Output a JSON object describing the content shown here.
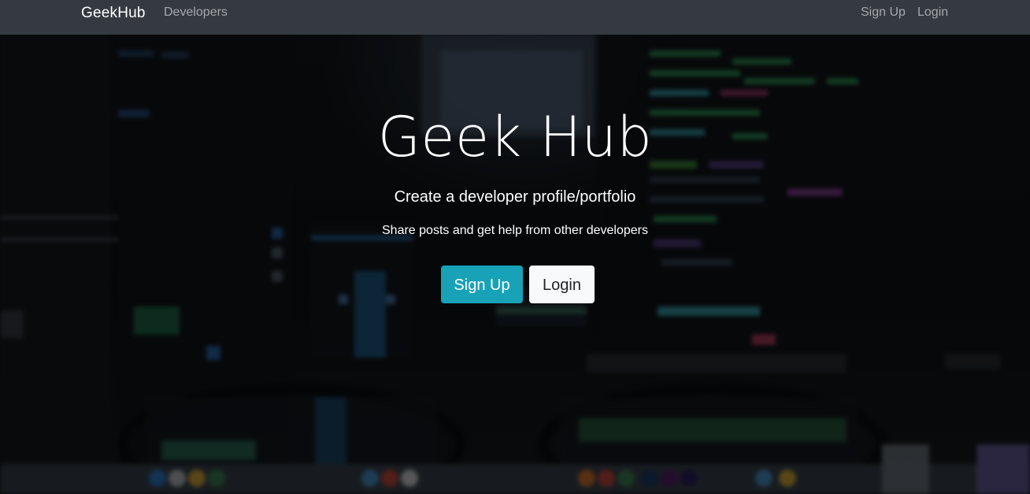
{
  "navbar": {
    "brand": "GeekHub",
    "links": {
      "developers": "Developers",
      "signup": "Sign Up",
      "login": "Login"
    }
  },
  "hero": {
    "title": "Geek Hub",
    "lead": "Create a developer profile/portfolio",
    "subtitle": "Share posts and get help from other developers",
    "buttons": {
      "signup": "Sign Up",
      "login": "Login"
    }
  },
  "colors": {
    "navbar_bg": "#343a40",
    "signup_button": "#17a2b8",
    "login_button": "#f8f9fa",
    "hero_overlay": "#000000"
  }
}
